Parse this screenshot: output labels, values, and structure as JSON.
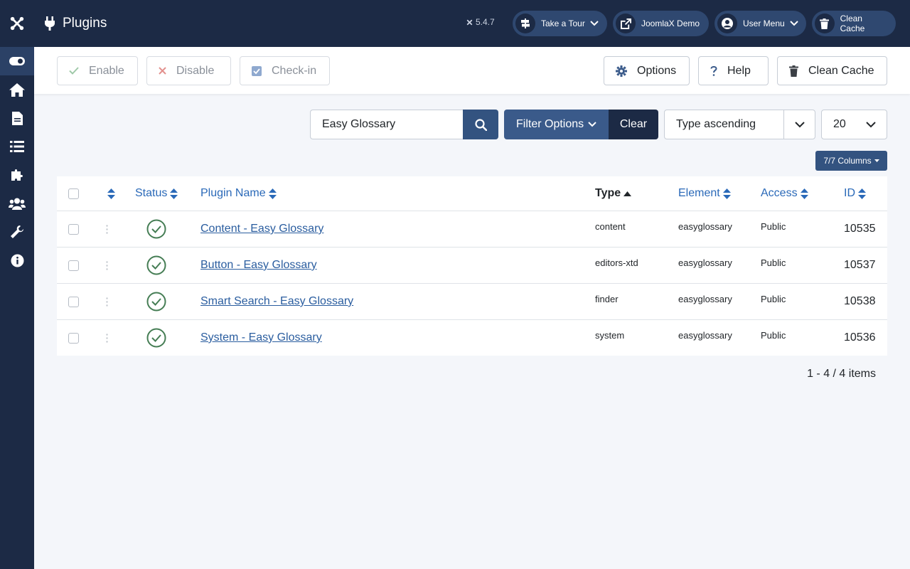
{
  "header": {
    "title": "Plugins",
    "version": "5.4.7",
    "buttons": {
      "tour": "Take a Tour",
      "demo": "JoomlaX Demo",
      "user": "User Menu",
      "cache": "Clean Cache"
    }
  },
  "sidebar": {
    "items": [
      "toggle-icon",
      "home-icon",
      "file-icon",
      "list-icon",
      "puzzle-icon",
      "users-icon",
      "wrench-icon",
      "info-icon"
    ]
  },
  "toolbar": {
    "enable": "Enable",
    "disable": "Disable",
    "checkin": "Check-in",
    "options": "Options",
    "help": "Help",
    "clean_cache": "Clean Cache"
  },
  "filters": {
    "search_value": "Easy Glossary",
    "filter_options": "Filter Options",
    "clear": "Clear",
    "ordering": "Type ascending",
    "limit": "20",
    "columns": "7/7 Columns"
  },
  "table": {
    "headers": {
      "status": "Status",
      "name": "Plugin Name",
      "type": "Type",
      "element": "Element",
      "access": "Access",
      "id": "ID"
    },
    "rows": [
      {
        "name": "Content - Easy Glossary",
        "type": "content",
        "element": "easyglossary",
        "access": "Public",
        "id": "10535"
      },
      {
        "name": "Button - Easy Glossary",
        "type": "editors-xtd",
        "element": "easyglossary",
        "access": "Public",
        "id": "10537"
      },
      {
        "name": "Smart Search - Easy Glossary",
        "type": "finder",
        "element": "easyglossary",
        "access": "Public",
        "id": "10538"
      },
      {
        "name": "System - Easy Glossary",
        "type": "system",
        "element": "easyglossary",
        "access": "Public",
        "id": "10536"
      }
    ]
  },
  "pagination": {
    "info": "1 - 4 / 4 items"
  },
  "colors": {
    "header_bg": "#1c2a45",
    "accent": "#335380",
    "link": "#2a5d9f",
    "success": "#457d54"
  }
}
